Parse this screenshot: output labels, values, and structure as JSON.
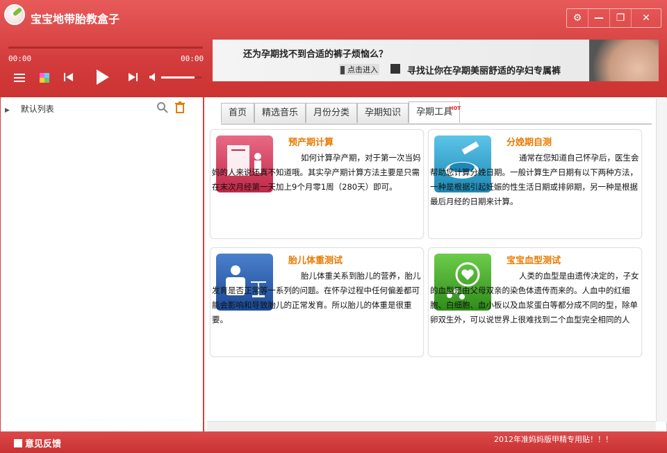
{
  "app": {
    "title": "宝宝地带胎教盒子"
  },
  "window_buttons": [
    {
      "name": "settings-icon",
      "glyph": "⚙"
    },
    {
      "name": "minimize-icon",
      "glyph": "—"
    },
    {
      "name": "restore-icon",
      "glyph": "❐"
    },
    {
      "name": "close-icon",
      "glyph": "✕"
    }
  ],
  "player": {
    "time_current": "00:00",
    "time_total": "00:00",
    "volume": 0.8
  },
  "banner": {
    "question": "还为孕期找不到合适的裤子烦恼么？",
    "click_label": "点击进入",
    "slogan": "寻找让你在孕期美丽舒适的孕妇专属裤"
  },
  "playlist": {
    "default_list": "默认列表"
  },
  "tabs": [
    {
      "label": "首页"
    },
    {
      "label": "精选音乐"
    },
    {
      "label": "月份分类"
    },
    {
      "label": "孕期知识"
    },
    {
      "label": "孕期工具",
      "badge": "HOT"
    }
  ],
  "cards": [
    {
      "title": "预产期计算",
      "text": "如何计算孕产期，对于第一次当妈妈的人来说还真不知道哦。其实孕产期计算方法主要是只需在末次月经第一天加上9个月零1周（280天）即可。",
      "icon": "notepad-person-icon",
      "color": "#d83c5c"
    },
    {
      "title": "分娩期自测",
      "text": "通常在您知道自己怀孕后，医生会帮助您计算分娩日期。一般计算生产日期有以下两种方法，一种是根据引起妊娠的性生活日期或排卵期，另一种是根据最后月经的日期来计算。",
      "icon": "hatchet-bowl-icon",
      "color": "#2ba0c8"
    },
    {
      "title": "胎儿体重测试",
      "text": "胎儿体重关系到胎儿的营养，胎儿发育是否正常等一系列的问题。在怀孕过程中任何偏差都可能会影响和导致胎儿的正常发育。所以胎儿的体重是很重要。",
      "icon": "person-scale-icon",
      "color": "#2a5fb0"
    },
    {
      "title": "宝宝血型测试",
      "text": "人类的血型是由遗传决定的，子女的血型是由父母双亲的染色体遗传而来的。人血中的红细胞、白细胞、血小板以及血浆蛋白等都分成不同的型，除单卵双生外，可以说世界上很难找到二个血型完全相同的人",
      "icon": "heart-bubble-icon",
      "color": "#3fa524"
    }
  ],
  "footer": {
    "feedback": "意见反馈",
    "notice": "2012年准妈妈版甲精专用贴！！！"
  }
}
